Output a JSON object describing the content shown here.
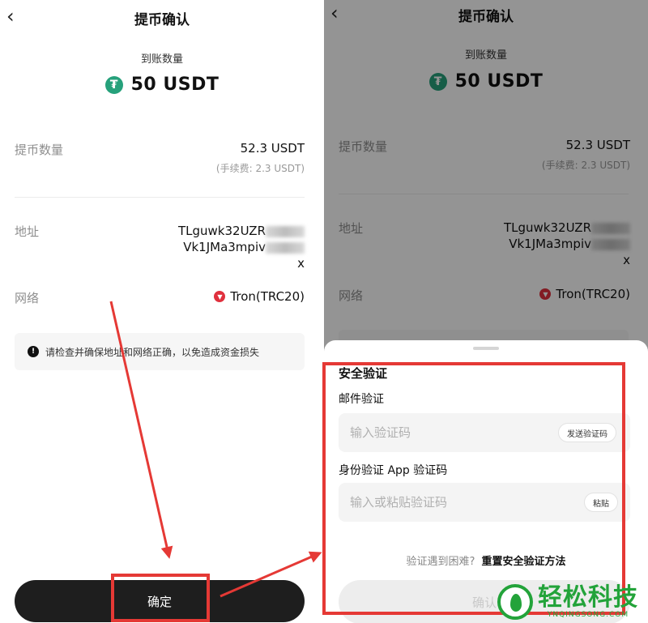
{
  "header": {
    "title": "提币确认",
    "back_glyph": "‹"
  },
  "receive": {
    "label": "到账数量",
    "amount": "50 USDT",
    "coin_icon_glyph": "₮"
  },
  "withdraw": {
    "label": "提币数量",
    "value": "52.3 USDT",
    "fee": "(手续费:  2.3 USDT)"
  },
  "address": {
    "label": "地址",
    "line1": "TLguwk32UZR",
    "line2": "Vk1JMa3mpiv",
    "tail": "x"
  },
  "network": {
    "label": "网络",
    "value": "Tron(TRC20)"
  },
  "notice": {
    "icon_glyph": "!",
    "text": "请检查并确保地址和网络正确，以免造成资金损失"
  },
  "confirm": {
    "label": "确定"
  },
  "security": {
    "title": "安全验证",
    "email_label": "邮件验证",
    "email_placeholder": "输入验证码",
    "send_code": "发送验证码",
    "app_label": "身份验证 App 验证码",
    "app_placeholder": "输入或粘贴验证码",
    "paste": "粘贴",
    "help_question": "验证遇到困难?",
    "help_link": "重置安全验证方法",
    "confirm_label": "确认"
  },
  "watermark": {
    "cn": "轻松科技",
    "en": "YNQINGSONG.COM"
  },
  "colors": {
    "usdt": "#26a17b",
    "tron": "#e0303d",
    "highlight": "#e53935",
    "watermark": "#23a33a"
  }
}
